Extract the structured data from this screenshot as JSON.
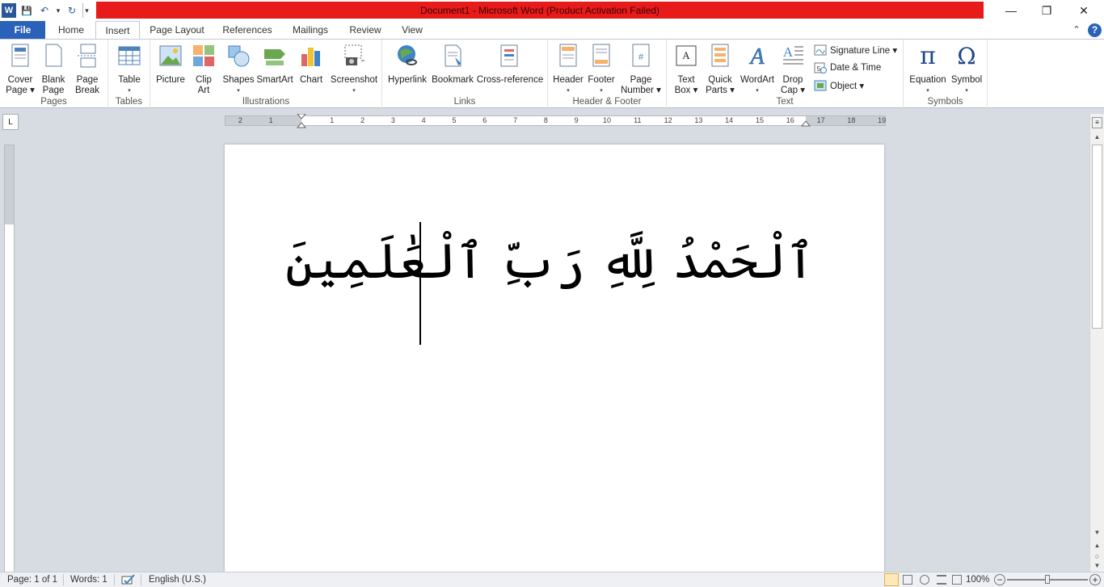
{
  "window": {
    "title": "Document1  -  Microsoft Word (Product Activation Failed)",
    "minimize": "—",
    "restore": "❐",
    "close": "✕"
  },
  "qat": {
    "app_icon": "W",
    "save": "💾",
    "undo": "↶",
    "undo_dd": "▾",
    "redo": "↻",
    "customize": "▾"
  },
  "tabs": {
    "file": "File",
    "items": [
      "Home",
      "Insert",
      "Page Layout",
      "References",
      "Mailings",
      "Review",
      "View"
    ],
    "active": "Insert",
    "collapse_ribbon": "⌃",
    "help": "?"
  },
  "ribbon": {
    "groups": {
      "pages": "Pages",
      "tables": "Tables",
      "illustrations": "Illustrations",
      "links": "Links",
      "header_footer": "Header & Footer",
      "text": "Text",
      "symbols": "Symbols"
    },
    "buttons": {
      "cover_page": [
        "Cover",
        "Page ▾"
      ],
      "blank_page": [
        "Blank",
        "Page"
      ],
      "page_break": [
        "Page",
        "Break"
      ],
      "table": [
        "Table",
        "▾"
      ],
      "picture": [
        "Picture",
        ""
      ],
      "clip_art": [
        "Clip",
        "Art"
      ],
      "shapes": [
        "Shapes",
        "▾"
      ],
      "smartart": [
        "SmartArt",
        ""
      ],
      "chart": [
        "Chart",
        ""
      ],
      "screenshot": [
        "Screenshot",
        "▾"
      ],
      "hyperlink": [
        "Hyperlink",
        ""
      ],
      "bookmark": [
        "Bookmark",
        ""
      ],
      "cross_reference": [
        "Cross-reference",
        ""
      ],
      "header": [
        "Header",
        "▾"
      ],
      "footer": [
        "Footer",
        "▾"
      ],
      "page_number": [
        "Page",
        "Number ▾"
      ],
      "text_box": [
        "Text",
        "Box ▾"
      ],
      "quick_parts": [
        "Quick",
        "Parts ▾"
      ],
      "wordart": [
        "WordArt",
        "▾"
      ],
      "drop_cap": [
        "Drop",
        "Cap ▾"
      ],
      "equation": [
        "Equation",
        "▾"
      ],
      "symbol": [
        "Symbol",
        "▾"
      ]
    },
    "small_buttons": {
      "signature_line": "Signature Line ▾",
      "date_time": "Date & Time",
      "object": "Object ▾"
    }
  },
  "ruler": {
    "corner": "L",
    "ticks": [
      "2",
      "1",
      "",
      "1",
      "2",
      "3",
      "4",
      "5",
      "6",
      "7",
      "8",
      "9",
      "10",
      "11",
      "12",
      "13",
      "14",
      "15",
      "16",
      "17",
      "18",
      "19"
    ]
  },
  "document": {
    "text": "ٱلْحَمْدُ لِلَّهِ رَبِّ ٱلْعَٰلَمِينَ"
  },
  "statusbar": {
    "page": "Page: 1 of 1",
    "words": "Words: 1",
    "language": "English (U.S.)",
    "zoom": "100%",
    "zoom_minus": "−",
    "zoom_plus": "+"
  },
  "colors": {
    "title_bar": "#e81b1b",
    "file_tab": "#2a62b9"
  }
}
